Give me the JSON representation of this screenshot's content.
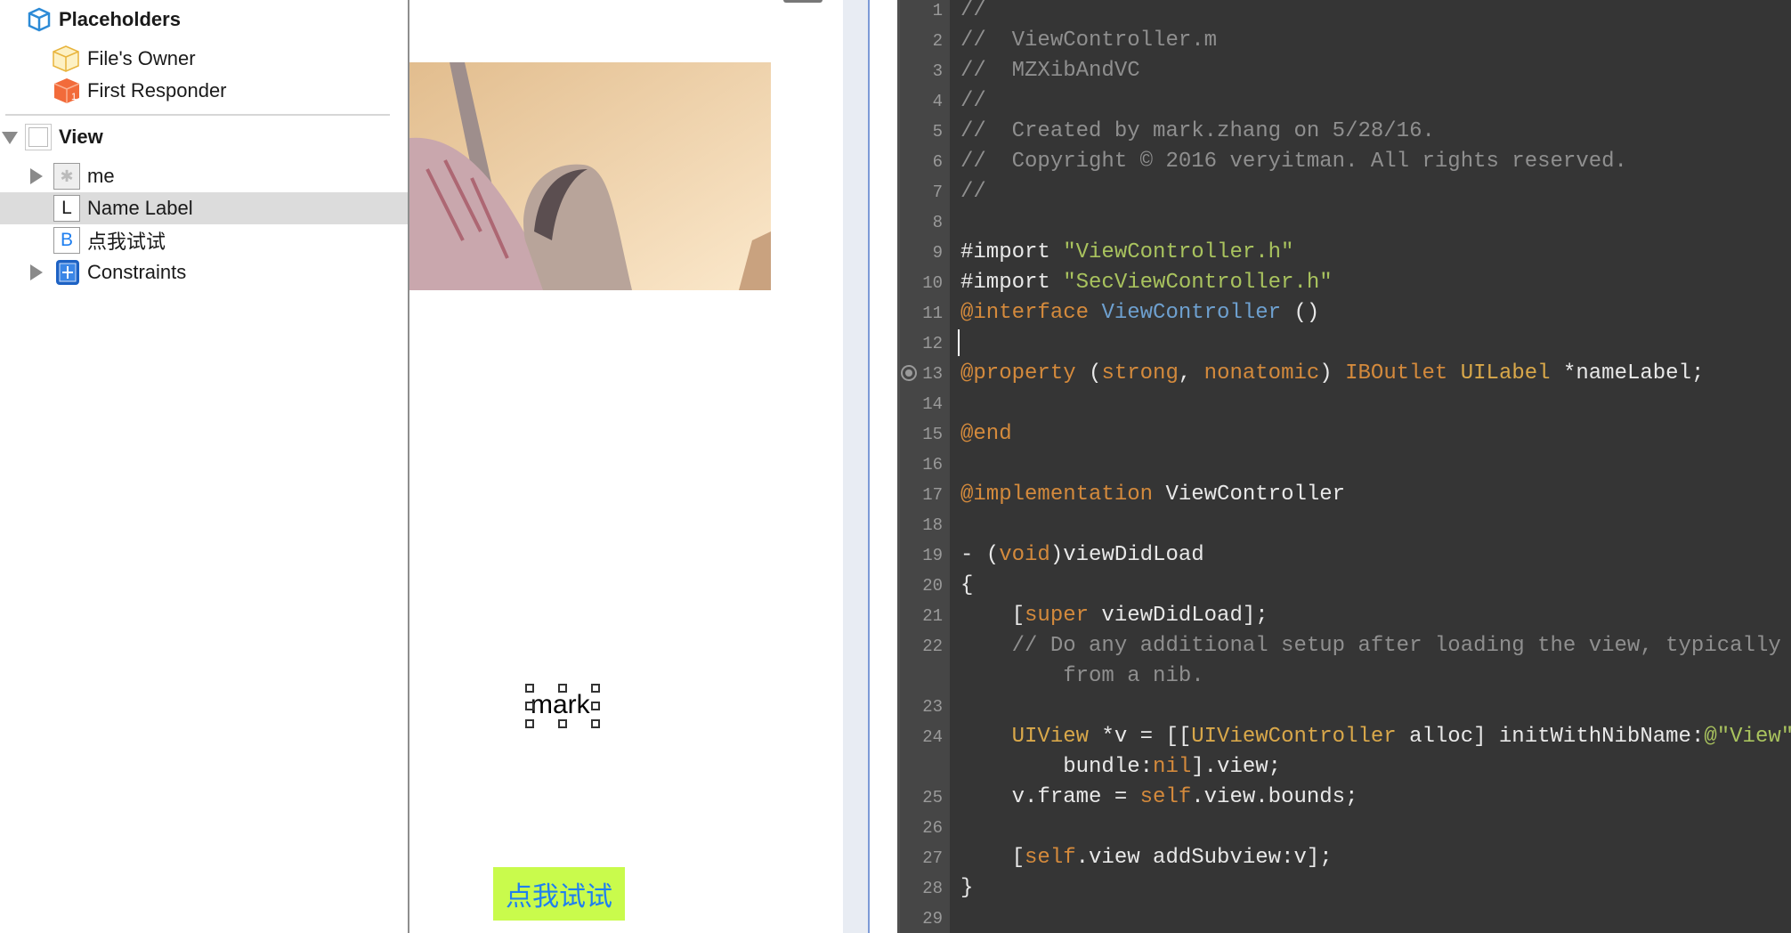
{
  "outline": {
    "placeholders": "Placeholders",
    "files_owner": "File's Owner",
    "first_responder": "First Responder",
    "view": "View",
    "children": [
      {
        "label": "me",
        "badge": "",
        "icon": "image-view-icon",
        "expandable": true
      },
      {
        "label": "Name Label",
        "badge": "L",
        "icon": "label-icon",
        "expandable": false,
        "selected": true
      },
      {
        "label": "点我试试",
        "badge": "B",
        "icon": "button-icon",
        "expandable": false
      },
      {
        "label": "Constraints",
        "badge": "",
        "icon": "constraints-icon",
        "expandable": true
      }
    ]
  },
  "canvas": {
    "name_label_text": "mark",
    "button_text": "点我试试",
    "button_bg": "#c9fb4c",
    "button_fg": "#1f7ff0"
  },
  "editor": {
    "colors": {
      "background": "#353535",
      "comment": "#8f8f8f",
      "string": "#a9c35e",
      "keyword": "#d48a3c",
      "class": "#6ea0cf",
      "type": "#d9a84a"
    },
    "lines": [
      {
        "n": "1",
        "segs": [
          {
            "t": "//",
            "c": "cmt"
          }
        ]
      },
      {
        "n": "2",
        "segs": [
          {
            "t": "//  ViewController.m",
            "c": "cmt"
          }
        ]
      },
      {
        "n": "3",
        "segs": [
          {
            "t": "//  MZXibAndVC",
            "c": "cmt"
          }
        ]
      },
      {
        "n": "4",
        "segs": [
          {
            "t": "//",
            "c": "cmt"
          }
        ]
      },
      {
        "n": "5",
        "segs": [
          {
            "t": "//  Created by mark.zhang on 5/28/16.",
            "c": "cmt"
          }
        ]
      },
      {
        "n": "6",
        "segs": [
          {
            "t": "//  Copyright © 2016 veryitman. All rights reserved.",
            "c": "cmt"
          }
        ]
      },
      {
        "n": "7",
        "segs": [
          {
            "t": "//",
            "c": "cmt"
          }
        ]
      },
      {
        "n": "8",
        "segs": []
      },
      {
        "n": "9",
        "segs": [
          {
            "t": "#import ",
            "c": "pl"
          },
          {
            "t": "\"ViewController.h\"",
            "c": "str"
          }
        ]
      },
      {
        "n": "10",
        "segs": [
          {
            "t": "#import ",
            "c": "pl"
          },
          {
            "t": "\"SecViewController.h\"",
            "c": "str"
          }
        ]
      },
      {
        "n": "11",
        "segs": [
          {
            "t": "@interface",
            "c": "kw"
          },
          {
            "t": " ",
            "c": "pl"
          },
          {
            "t": "ViewController",
            "c": "cls"
          },
          {
            "t": " ()",
            "c": "pl"
          }
        ]
      },
      {
        "n": "12",
        "segs": []
      },
      {
        "n": "13",
        "segs": [
          {
            "t": "@property",
            "c": "kw"
          },
          {
            "t": " (",
            "c": "pl"
          },
          {
            "t": "strong",
            "c": "kw"
          },
          {
            "t": ", ",
            "c": "pl"
          },
          {
            "t": "nonatomic",
            "c": "kw"
          },
          {
            "t": ") ",
            "c": "pl"
          },
          {
            "t": "IBOutlet",
            "c": "kw"
          },
          {
            "t": " ",
            "c": "pl"
          },
          {
            "t": "UILabel",
            "c": "typ"
          },
          {
            "t": " *nameLabel;",
            "c": "pl"
          }
        ]
      },
      {
        "n": "14",
        "segs": []
      },
      {
        "n": "15",
        "segs": [
          {
            "t": "@end",
            "c": "kw"
          }
        ]
      },
      {
        "n": "16",
        "segs": []
      },
      {
        "n": "17",
        "segs": [
          {
            "t": "@implementation",
            "c": "kw"
          },
          {
            "t": " ViewController",
            "c": "pl"
          }
        ]
      },
      {
        "n": "18",
        "segs": []
      },
      {
        "n": "19",
        "segs": [
          {
            "t": "- (",
            "c": "pl"
          },
          {
            "t": "void",
            "c": "kw"
          },
          {
            "t": ")viewDidLoad",
            "c": "pl"
          }
        ]
      },
      {
        "n": "20",
        "segs": [
          {
            "t": "{",
            "c": "pl"
          }
        ]
      },
      {
        "n": "21",
        "segs": [
          {
            "t": "    [",
            "c": "pl"
          },
          {
            "t": "super",
            "c": "kw"
          },
          {
            "t": " viewDidLoad];",
            "c": "pl"
          }
        ]
      },
      {
        "n": "22",
        "segs": [
          {
            "t": "    // Do any additional setup after loading the view, typically",
            "c": "cmt"
          }
        ]
      },
      {
        "n": "",
        "segs": [
          {
            "t": "        from a nib.",
            "c": "cmt"
          }
        ]
      },
      {
        "n": "23",
        "segs": []
      },
      {
        "n": "24",
        "segs": [
          {
            "t": "    ",
            "c": "pl"
          },
          {
            "t": "UIView",
            "c": "typ"
          },
          {
            "t": " *v = [[",
            "c": "pl"
          },
          {
            "t": "UIViewController",
            "c": "typ"
          },
          {
            "t": " alloc] initWithNibName:",
            "c": "pl"
          },
          {
            "t": "@\"View\"",
            "c": "str"
          }
        ]
      },
      {
        "n": "",
        "segs": [
          {
            "t": "        bundle:",
            "c": "pl"
          },
          {
            "t": "nil",
            "c": "kw"
          },
          {
            "t": "].view;",
            "c": "pl"
          }
        ]
      },
      {
        "n": "25",
        "segs": [
          {
            "t": "    v.frame = ",
            "c": "pl"
          },
          {
            "t": "self",
            "c": "kw"
          },
          {
            "t": ".view.bounds;",
            "c": "pl"
          }
        ]
      },
      {
        "n": "26",
        "segs": []
      },
      {
        "n": "27",
        "segs": [
          {
            "t": "    [",
            "c": "pl"
          },
          {
            "t": "self",
            "c": "kw"
          },
          {
            "t": ".view addSubview:v];",
            "c": "pl"
          }
        ]
      },
      {
        "n": "28",
        "segs": [
          {
            "t": "}",
            "c": "pl"
          }
        ]
      },
      {
        "n": "29",
        "segs": []
      }
    ]
  }
}
